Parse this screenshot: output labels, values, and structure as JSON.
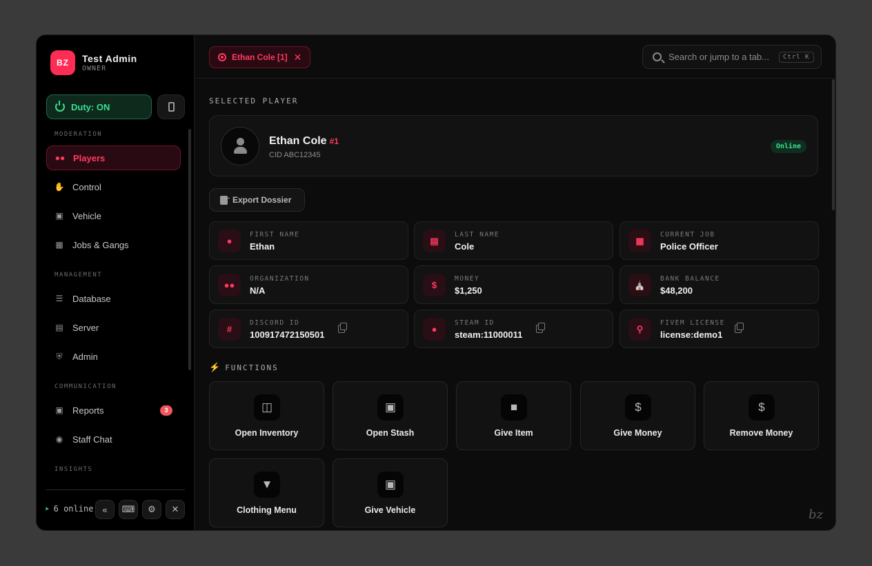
{
  "user": {
    "initials": "BZ",
    "name": "Test Admin",
    "role": "OWNER"
  },
  "duty": {
    "label": "Duty: ON"
  },
  "sidebar": {
    "sections": [
      {
        "label": "MODERATION"
      },
      {
        "label": "MANAGEMENT"
      },
      {
        "label": "COMMUNICATION"
      },
      {
        "label": "INSIGHTS"
      }
    ],
    "items": [
      {
        "label": "Players",
        "icon": "users-icon"
      },
      {
        "label": "Control",
        "icon": "hand-icon"
      },
      {
        "label": "Vehicle",
        "icon": "car-icon"
      },
      {
        "label": "Jobs & Gangs",
        "icon": "briefcase-icon"
      },
      {
        "label": "Database",
        "icon": "database-icon"
      },
      {
        "label": "Server",
        "icon": "server-icon"
      },
      {
        "label": "Admin",
        "icon": "shield-icon"
      },
      {
        "label": "Reports",
        "icon": "message-icon",
        "badge": "3"
      },
      {
        "label": "Staff Chat",
        "icon": "chat-icon"
      }
    ],
    "online": "6 online"
  },
  "tab": {
    "label": "Ethan Cole [1]"
  },
  "search": {
    "placeholder": "Search or jump to a tab...",
    "shortcut": "Ctrl K"
  },
  "selected": {
    "heading": "SELECTED PLAYER",
    "name": "Ethan Cole",
    "id": "#1",
    "cid": "CID ABC12345",
    "status": "Online",
    "status_color": "#3be08f"
  },
  "export": {
    "label": "Export Dossier"
  },
  "info": [
    {
      "label": "FIRST NAME",
      "value": "Ethan",
      "icon": "person-icon"
    },
    {
      "label": "LAST NAME",
      "value": "Cole",
      "icon": "id-card-icon"
    },
    {
      "label": "CURRENT JOB",
      "value": "Police Officer",
      "icon": "briefcase-icon"
    },
    {
      "label": "ORGANIZATION",
      "value": "N/A",
      "icon": "group-icon"
    },
    {
      "label": "MONEY",
      "value": "$1,250",
      "icon": "money-bag-icon"
    },
    {
      "label": "BANK BALANCE",
      "value": "$48,200",
      "icon": "bank-icon"
    },
    {
      "label": "DISCORD ID",
      "value": "100917472150501",
      "icon": "hash-icon"
    },
    {
      "label": "STEAM ID",
      "value": "steam:11000011",
      "icon": "gamepad-icon"
    },
    {
      "label": "FIVEM LICENSE",
      "value": "license:demo1",
      "icon": "key-icon"
    }
  ],
  "functions": {
    "heading": "FUNCTIONS",
    "items": [
      {
        "label": "Open Inventory",
        "icon": "box-open-icon"
      },
      {
        "label": "Open Stash",
        "icon": "vault-icon"
      },
      {
        "label": "Give Item",
        "icon": "box-icon"
      },
      {
        "label": "Give Money",
        "icon": "money-bag-icon"
      },
      {
        "label": "Remove Money",
        "icon": "hand-dollar-icon"
      },
      {
        "label": "Clothing Menu",
        "icon": "shirt-icon"
      },
      {
        "label": "Give Vehicle",
        "icon": "car-icon"
      }
    ]
  },
  "accent": "#ff3a5f"
}
